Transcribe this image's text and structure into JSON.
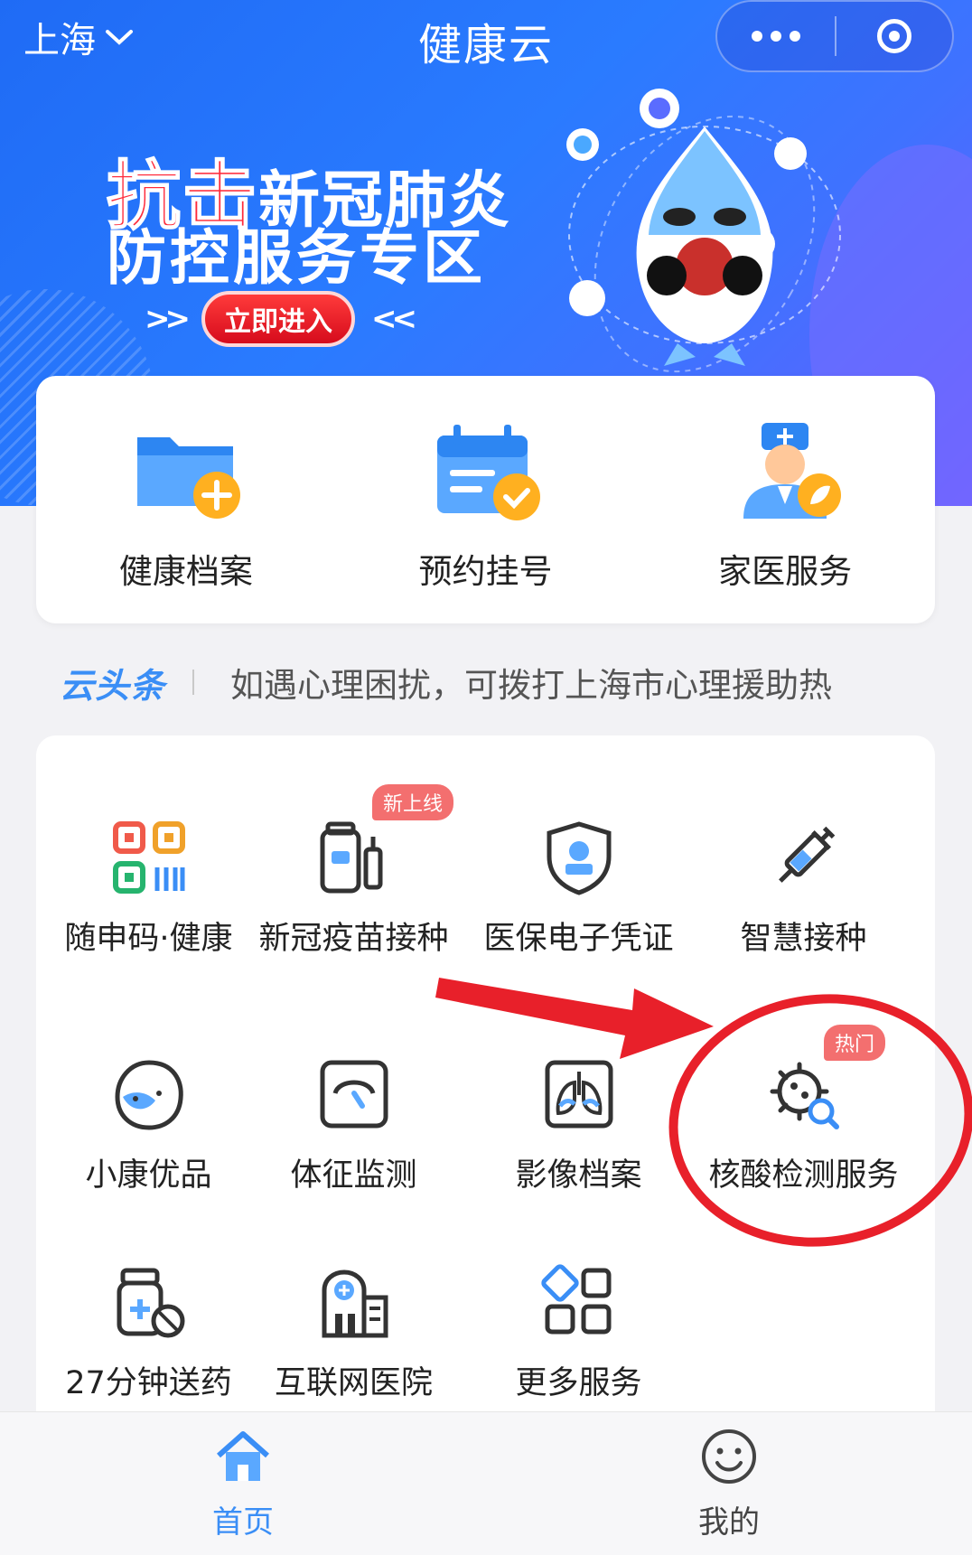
{
  "header": {
    "city": "上海",
    "title": "健康云"
  },
  "banner": {
    "highlight": "抗击",
    "line1_rest": "新冠肺炎",
    "line2": "防控服务专区",
    "enter_button": "立即进入",
    "chevron_left": ">>",
    "chevron_right": "<<"
  },
  "quick_actions": [
    {
      "label": "健康档案",
      "icon": "folder-plus-icon"
    },
    {
      "label": "预约挂号",
      "icon": "calendar-check-icon"
    },
    {
      "label": "家医服务",
      "icon": "doctor-icon"
    }
  ],
  "news": {
    "brand": "云头条",
    "text": "如遇心理困扰，可拨打上海市心理援助热"
  },
  "services": [
    {
      "label": "随申码·健康",
      "icon": "qr-code-icon"
    },
    {
      "label": "新冠疫苗接种",
      "icon": "vaccine-vial-icon",
      "badge": "新上线"
    },
    {
      "label": "医保电子凭证",
      "icon": "shield-badge-icon"
    },
    {
      "label": "智慧接种",
      "icon": "syringe-icon"
    },
    {
      "label": "小康优品",
      "icon": "mascot-face-icon"
    },
    {
      "label": "体征监测",
      "icon": "gauge-icon"
    },
    {
      "label": "影像档案",
      "icon": "lungs-icon"
    },
    {
      "label": "核酸检测服务",
      "icon": "virus-search-icon",
      "badge": "热门"
    },
    {
      "label": "27分钟送药",
      "icon": "medicine-bottle-icon"
    },
    {
      "label": "互联网医院",
      "icon": "hospital-icon"
    },
    {
      "label": "更多服务",
      "icon": "grid-more-icon"
    }
  ],
  "tabbar": [
    {
      "label": "首页",
      "icon": "home-icon",
      "active": true
    },
    {
      "label": "我的",
      "icon": "smiley-icon",
      "active": false
    }
  ],
  "colors": {
    "accent": "#3a8ef6",
    "annotation": "#e8202a",
    "badge": "#f36f6f"
  }
}
